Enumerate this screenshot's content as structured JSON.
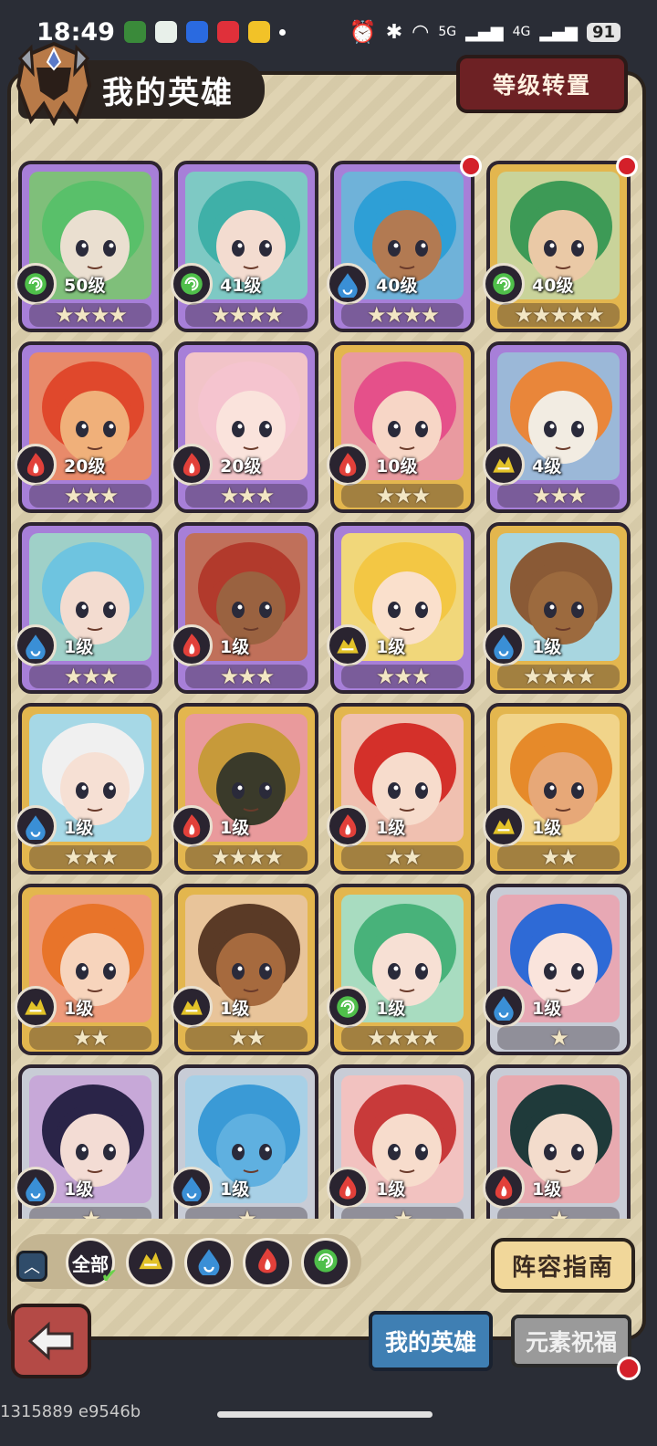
{
  "status_bar": {
    "time": "18:49",
    "battery": "91",
    "signal_a": "5G",
    "signal_b": "4G",
    "icons": [
      "alarm-icon",
      "bluetooth-icon",
      "wifi-icon"
    ]
  },
  "header": {
    "title": "我的英雄",
    "transfer_button": "等级转置"
  },
  "heroes": [
    {
      "level": "50级",
      "stars": 4,
      "element": "wind",
      "frame": "purple",
      "bg": "#7fbf7a",
      "hair": "#59c06a",
      "skin": "#eadfd0",
      "red_dot": false
    },
    {
      "level": "41级",
      "stars": 4,
      "element": "wind",
      "frame": "purple",
      "bg": "#7ec9c4",
      "hair": "#3fb0a8",
      "skin": "#f3dcd0",
      "red_dot": false
    },
    {
      "level": "40级",
      "stars": 4,
      "element": "water",
      "frame": "purple",
      "bg": "#6fb2d9",
      "hair": "#2e9fd6",
      "skin": "#b27a52",
      "red_dot": true
    },
    {
      "level": "40级",
      "stars": 5,
      "element": "wind",
      "frame": "gold",
      "bg": "#c9d39a",
      "hair": "#3d9a56",
      "skin": "#eac9a6",
      "red_dot": true
    },
    {
      "level": "20级",
      "stars": 3,
      "element": "fire",
      "frame": "purple",
      "bg": "#e88a6a",
      "hair": "#e0482c",
      "skin": "#f0b07a",
      "red_dot": false
    },
    {
      "level": "20级",
      "stars": 3,
      "element": "fire",
      "frame": "purple",
      "bg": "#f2c4c8",
      "hair": "#f5c4cf",
      "skin": "#fae3dc",
      "red_dot": false
    },
    {
      "level": "10级",
      "stars": 3,
      "element": "fire",
      "frame": "gold",
      "bg": "#e99aa0",
      "hair": "#e5508a",
      "skin": "#f7d6c6",
      "red_dot": false
    },
    {
      "level": "4级",
      "stars": 3,
      "element": "earth",
      "frame": "purple",
      "bg": "#9bb8d8",
      "hair": "#e9863a",
      "skin": "#f2ece2",
      "red_dot": false
    },
    {
      "level": "1级",
      "stars": 3,
      "element": "water",
      "frame": "purple",
      "bg": "#9fd0c8",
      "hair": "#6ec4e0",
      "skin": "#f3dcd0",
      "red_dot": false
    },
    {
      "level": "1级",
      "stars": 3,
      "element": "fire",
      "frame": "purple",
      "bg": "#c0705a",
      "hair": "#b23a2c",
      "skin": "#9a6240",
      "red_dot": false
    },
    {
      "level": "1级",
      "stars": 3,
      "element": "earth",
      "frame": "purple",
      "bg": "#f1d77a",
      "hair": "#f3c744",
      "skin": "#fae0cc",
      "red_dot": false
    },
    {
      "level": "1级",
      "stars": 4,
      "element": "water",
      "frame": "gold",
      "bg": "#a8d6e0",
      "hair": "#8a5a36",
      "skin": "#9c6a3e",
      "red_dot": false
    },
    {
      "level": "1级",
      "stars": 3,
      "element": "water",
      "frame": "gold",
      "bg": "#a6d8e6",
      "hair": "#f0f0f0",
      "skin": "#f6e0d4",
      "red_dot": false
    },
    {
      "level": "1级",
      "stars": 4,
      "element": "fire",
      "frame": "gold",
      "bg": "#e99a9c",
      "hair": "#c79a3a",
      "skin": "#3a3a2a",
      "red_dot": false
    },
    {
      "level": "1级",
      "stars": 2,
      "element": "fire",
      "frame": "gold",
      "bg": "#f0c0b0",
      "hair": "#d4302a",
      "skin": "#f7dccc",
      "red_dot": false
    },
    {
      "level": "1级",
      "stars": 2,
      "element": "earth",
      "frame": "gold",
      "bg": "#f1d48a",
      "hair": "#e68a2a",
      "skin": "#e7a878",
      "red_dot": false
    },
    {
      "level": "1级",
      "stars": 2,
      "element": "earth",
      "frame": "gold",
      "bg": "#ee9a7a",
      "hair": "#e8742a",
      "skin": "#f7d4bc",
      "red_dot": false
    },
    {
      "level": "1级",
      "stars": 2,
      "element": "earth",
      "frame": "gold",
      "bg": "#e8c49a",
      "hair": "#5a3a26",
      "skin": "#a66a3e",
      "red_dot": false
    },
    {
      "level": "1级",
      "stars": 4,
      "element": "wind",
      "frame": "gold",
      "bg": "#a8dcc0",
      "hair": "#48b27a",
      "skin": "#f7e0d4",
      "red_dot": false
    },
    {
      "level": "1级",
      "stars": 1,
      "element": "water",
      "frame": "silver",
      "bg": "#e7a8b4",
      "hair": "#2e6ad6",
      "skin": "#fae4dc",
      "red_dot": false
    },
    {
      "level": "1级",
      "stars": 1,
      "element": "water",
      "frame": "silver",
      "bg": "#c7a8d8",
      "hair": "#2a2448",
      "skin": "#f3dcd4",
      "red_dot": false
    },
    {
      "level": "1级",
      "stars": 1,
      "element": "water",
      "frame": "silver",
      "bg": "#a8d0e6",
      "hair": "#3a9ad6",
      "skin": "#5fb0e0",
      "red_dot": false
    },
    {
      "level": "1级",
      "stars": 1,
      "element": "fire",
      "frame": "silver",
      "bg": "#f2c2c0",
      "hair": "#c83a3a",
      "skin": "#f7dccc",
      "red_dot": false
    },
    {
      "level": "1级",
      "stars": 1,
      "element": "fire",
      "frame": "silver",
      "bg": "#e8aab0",
      "hair": "#1f3a3a",
      "skin": "#f3dccc",
      "red_dot": false
    }
  ],
  "filters": {
    "all_label": "全部",
    "elements": [
      "earth",
      "water",
      "fire",
      "wind"
    ],
    "selected": "全部"
  },
  "guide_button": "阵容指南",
  "bottom_tabs": {
    "active": "我的英雄",
    "other": "元素祝福"
  },
  "debug_text": "1315889 e9546b",
  "colors": {
    "frame_purple": "#a77fd8",
    "frame_gold": "#e3b64e",
    "frame_silver": "#c8ccd6",
    "element_wind": "#4fbf4a",
    "element_water": "#3a8fd6",
    "element_fire": "#e2403a",
    "element_earth": "#e2c228"
  }
}
